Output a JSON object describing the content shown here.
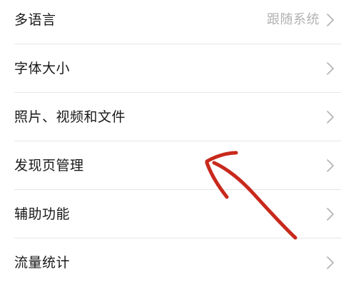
{
  "settings": {
    "items": [
      {
        "label": "多语言",
        "value": "跟随系统"
      },
      {
        "label": "字体大小"
      },
      {
        "label": "照片、视频和文件"
      },
      {
        "label": "发现页管理"
      },
      {
        "label": "辅助功能"
      },
      {
        "label": "流量统计"
      }
    ]
  },
  "icons": {
    "chevron": "chevron-right-icon",
    "annotation": "hand-drawn-arrow"
  },
  "colors": {
    "label": "#191919",
    "value": "#b2b2b2",
    "divider": "#e6e6e6",
    "chevron": "#b2b2b2",
    "annotation_arrow": "#c8291c"
  }
}
